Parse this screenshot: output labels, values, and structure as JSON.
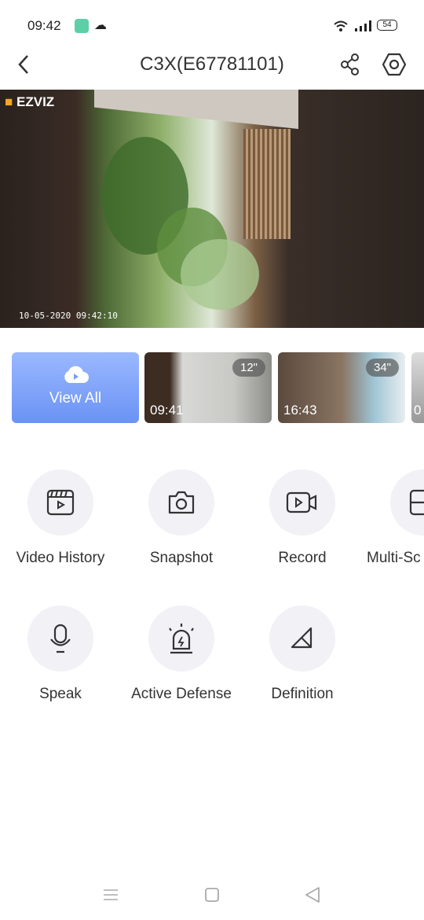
{
  "status_bar": {
    "time": "09:42",
    "battery": "54"
  },
  "header": {
    "title": "C3X(E67781101)",
    "back_icon": "chevron-left-icon",
    "share_icon": "share-icon",
    "settings_icon": "hexagon-settings-icon"
  },
  "live_view": {
    "logo": "EZVIZ",
    "timestamp": "10-05-2020 09:42:10"
  },
  "recordings": {
    "view_all_label": "View All",
    "clips": [
      {
        "duration": "12\"",
        "time": "09:41"
      },
      {
        "duration": "34\"",
        "time": "16:43"
      },
      {
        "duration": "",
        "time": "0"
      }
    ]
  },
  "actions": [
    {
      "label": "Video History",
      "icon": "video-history-icon"
    },
    {
      "label": "Snapshot",
      "icon": "camera-icon"
    },
    {
      "label": "Record",
      "icon": "video-record-icon"
    },
    {
      "label": "Multi-Sc",
      "icon": "multi-screen-icon"
    },
    {
      "label": "Speak",
      "icon": "microphone-icon"
    },
    {
      "label": "Active Defense",
      "icon": "siren-icon"
    },
    {
      "label": "Definition",
      "icon": "definition-icon"
    }
  ],
  "colors": {
    "accent": "#6a93f5",
    "circle_bg": "#f1f1f6"
  }
}
